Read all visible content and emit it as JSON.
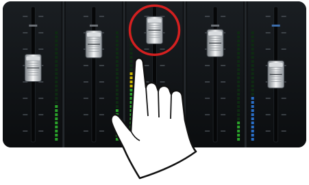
{
  "mixer": {
    "channel_count": 5,
    "highlight_ring_color": "#d42020",
    "meter_colors": {
      "low": "#2aa32a",
      "mid": "#c8b400",
      "high": "#c82020",
      "off": "#0e2a12"
    },
    "faders": [
      {
        "id": "ch1",
        "level": 0.56,
        "meter_level": 0.34,
        "meter_side": "right",
        "meter_color": "green"
      },
      {
        "id": "ch2",
        "level": 0.78,
        "meter_level": 0.3,
        "meter_side": "right",
        "meter_color": "green"
      },
      {
        "id": "ch3",
        "level": 0.91,
        "meter_level": 0.64,
        "meter_side": "left",
        "meter_color": "yellow",
        "highlighted": true,
        "touched": true
      },
      {
        "id": "ch4",
        "level": 0.79,
        "meter_level": 0.18,
        "meter_side": "right",
        "meter_color": "green"
      },
      {
        "id": "ch5",
        "level": 0.5,
        "meter_level": 0.4,
        "meter_side": "left",
        "meter_color": "blue"
      }
    ]
  },
  "gesture": {
    "icon": "pointing-hand-icon",
    "action": "touch-and-drag"
  }
}
